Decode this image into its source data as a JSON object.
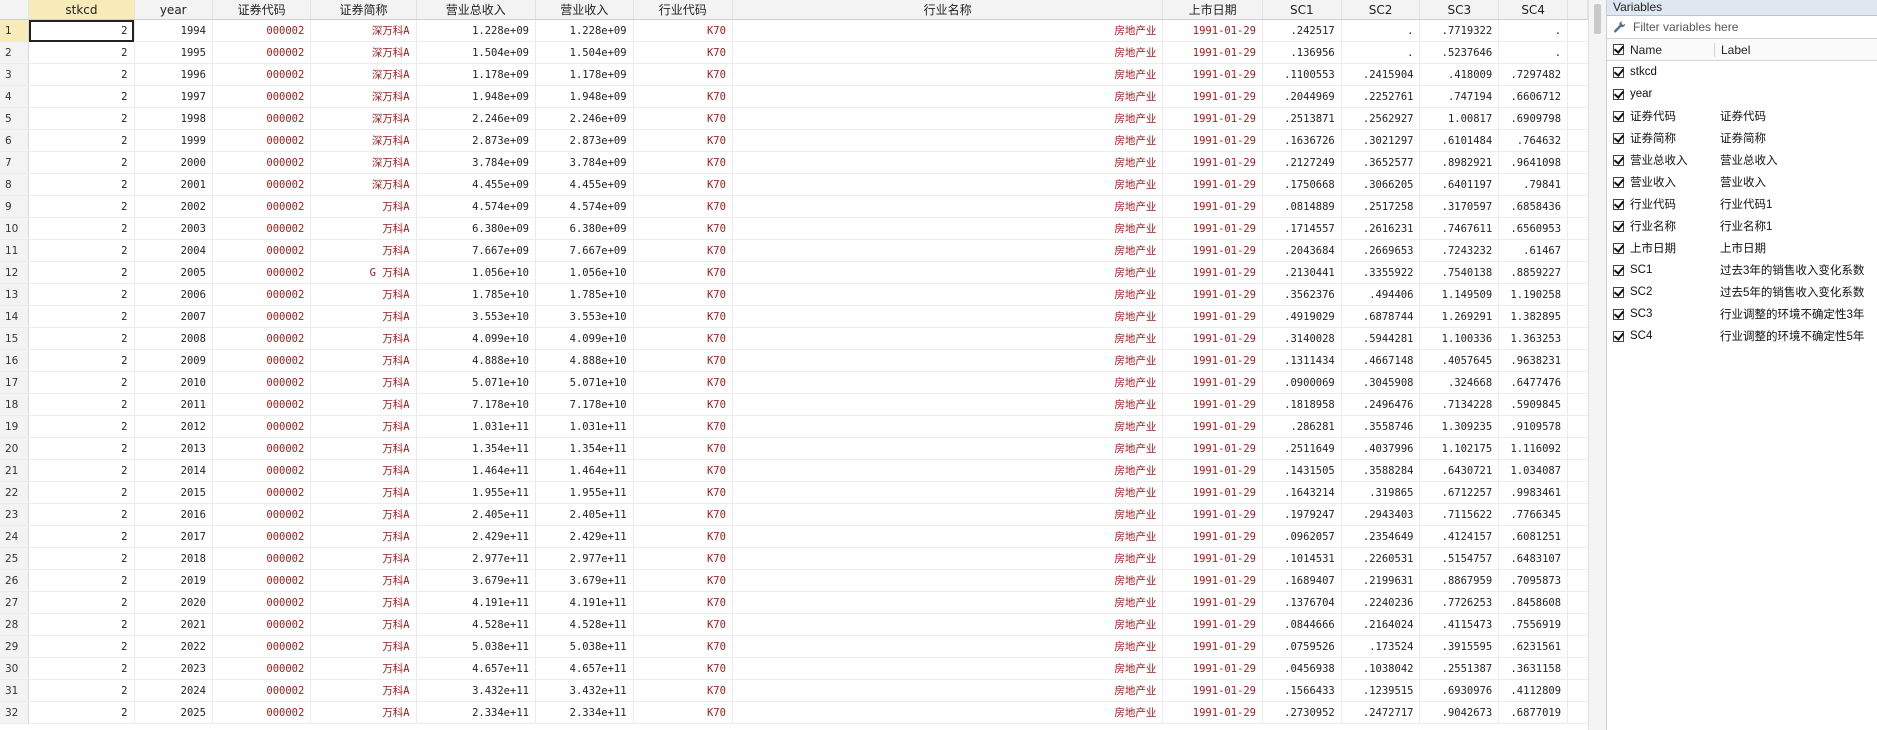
{
  "grid": {
    "columns": [
      {
        "key": "stkcd",
        "label": "stkcd",
        "type": "num",
        "width": 106
      },
      {
        "key": "year",
        "label": "year",
        "type": "num",
        "width": 79
      },
      {
        "key": "code",
        "label": "证券代码",
        "type": "str",
        "width": 99
      },
      {
        "key": "abbr",
        "label": "证券简称",
        "type": "str",
        "width": 106
      },
      {
        "key": "rev_total",
        "label": "营业总收入",
        "type": "num",
        "width": 120
      },
      {
        "key": "rev",
        "label": "营业收入",
        "type": "num",
        "width": 98
      },
      {
        "key": "ind_code",
        "label": "行业代码",
        "type": "str",
        "width": 100
      },
      {
        "key": "ind_name",
        "label": "行业名称",
        "type": "str",
        "width": 435
      },
      {
        "key": "list_date",
        "label": "上市日期",
        "type": "str",
        "width": 100
      },
      {
        "key": "sc1",
        "label": "SC1",
        "type": "num",
        "width": 79
      },
      {
        "key": "sc2",
        "label": "SC2",
        "type": "num",
        "width": 79
      },
      {
        "key": "sc3",
        "label": "SC3",
        "type": "num",
        "width": 79
      },
      {
        "key": "sc4",
        "label": "SC4",
        "type": "num",
        "width": 69
      }
    ],
    "rows": [
      [
        "1",
        "2",
        "1994",
        "000002",
        "深万科A",
        "1.228e+09",
        "1.228e+09",
        "K70",
        "房地产业",
        "1991-01-29",
        ".242517",
        ".",
        ".7719322",
        "."
      ],
      [
        "2",
        "2",
        "1995",
        "000002",
        "深万科A",
        "1.504e+09",
        "1.504e+09",
        "K70",
        "房地产业",
        "1991-01-29",
        ".136956",
        ".",
        ".5237646",
        "."
      ],
      [
        "3",
        "2",
        "1996",
        "000002",
        "深万科A",
        "1.178e+09",
        "1.178e+09",
        "K70",
        "房地产业",
        "1991-01-29",
        ".1100553",
        ".2415904",
        ".418009",
        ".7297482"
      ],
      [
        "4",
        "2",
        "1997",
        "000002",
        "深万科A",
        "1.948e+09",
        "1.948e+09",
        "K70",
        "房地产业",
        "1991-01-29",
        ".2044969",
        ".2252761",
        ".747194",
        ".6606712"
      ],
      [
        "5",
        "2",
        "1998",
        "000002",
        "深万科A",
        "2.246e+09",
        "2.246e+09",
        "K70",
        "房地产业",
        "1991-01-29",
        ".2513871",
        ".2562927",
        "1.00817",
        ".6909798"
      ],
      [
        "6",
        "2",
        "1999",
        "000002",
        "深万科A",
        "2.873e+09",
        "2.873e+09",
        "K70",
        "房地产业",
        "1991-01-29",
        ".1636726",
        ".3021297",
        ".6101484",
        ".764632"
      ],
      [
        "7",
        "2",
        "2000",
        "000002",
        "深万科A",
        "3.784e+09",
        "3.784e+09",
        "K70",
        "房地产业",
        "1991-01-29",
        ".2127249",
        ".3652577",
        ".8982921",
        ".9641098"
      ],
      [
        "8",
        "2",
        "2001",
        "000002",
        "深万科A",
        "4.455e+09",
        "4.455e+09",
        "K70",
        "房地产业",
        "1991-01-29",
        ".1750668",
        ".3066205",
        ".6401197",
        ".79841"
      ],
      [
        "9",
        "2",
        "2002",
        "000002",
        "万科A",
        "4.574e+09",
        "4.574e+09",
        "K70",
        "房地产业",
        "1991-01-29",
        ".0814889",
        ".2517258",
        ".3170597",
        ".6858436"
      ],
      [
        "10",
        "2",
        "2003",
        "000002",
        "万科A",
        "6.380e+09",
        "6.380e+09",
        "K70",
        "房地产业",
        "1991-01-29",
        ".1714557",
        ".2616231",
        ".7467611",
        ".6560953"
      ],
      [
        "11",
        "2",
        "2004",
        "000002",
        "万科A",
        "7.667e+09",
        "7.667e+09",
        "K70",
        "房地产业",
        "1991-01-29",
        ".2043684",
        ".2669653",
        ".7243232",
        ".61467"
      ],
      [
        "12",
        "2",
        "2005",
        "000002",
        "G 万科A",
        "1.056e+10",
        "1.056e+10",
        "K70",
        "房地产业",
        "1991-01-29",
        ".2130441",
        ".3355922",
        ".7540138",
        ".8859227"
      ],
      [
        "13",
        "2",
        "2006",
        "000002",
        "万科A",
        "1.785e+10",
        "1.785e+10",
        "K70",
        "房地产业",
        "1991-01-29",
        ".3562376",
        ".494406",
        "1.149509",
        "1.190258"
      ],
      [
        "14",
        "2",
        "2007",
        "000002",
        "万科A",
        "3.553e+10",
        "3.553e+10",
        "K70",
        "房地产业",
        "1991-01-29",
        ".4919029",
        ".6878744",
        "1.269291",
        "1.382895"
      ],
      [
        "15",
        "2",
        "2008",
        "000002",
        "万科A",
        "4.099e+10",
        "4.099e+10",
        "K70",
        "房地产业",
        "1991-01-29",
        ".3140028",
        ".5944281",
        "1.100336",
        "1.363253"
      ],
      [
        "16",
        "2",
        "2009",
        "000002",
        "万科A",
        "4.888e+10",
        "4.888e+10",
        "K70",
        "房地产业",
        "1991-01-29",
        ".1311434",
        ".4667148",
        ".4057645",
        ".9638231"
      ],
      [
        "17",
        "2",
        "2010",
        "000002",
        "万科A",
        "5.071e+10",
        "5.071e+10",
        "K70",
        "房地产业",
        "1991-01-29",
        ".0900069",
        ".3045908",
        ".324668",
        ".6477476"
      ],
      [
        "18",
        "2",
        "2011",
        "000002",
        "万科A",
        "7.178e+10",
        "7.178e+10",
        "K70",
        "房地产业",
        "1991-01-29",
        ".1818958",
        ".2496476",
        ".7134228",
        ".5909845"
      ],
      [
        "19",
        "2",
        "2012",
        "000002",
        "万科A",
        "1.031e+11",
        "1.031e+11",
        "K70",
        "房地产业",
        "1991-01-29",
        ".286281",
        ".3558746",
        "1.309235",
        ".9109578"
      ],
      [
        "20",
        "2",
        "2013",
        "000002",
        "万科A",
        "1.354e+11",
        "1.354e+11",
        "K70",
        "房地产业",
        "1991-01-29",
        ".2511649",
        ".4037996",
        "1.102175",
        "1.116092"
      ],
      [
        "21",
        "2",
        "2014",
        "000002",
        "万科A",
        "1.464e+11",
        "1.464e+11",
        "K70",
        "房地产业",
        "1991-01-29",
        ".1431505",
        ".3588284",
        ".6430721",
        "1.034087"
      ],
      [
        "22",
        "2",
        "2015",
        "000002",
        "万科A",
        "1.955e+11",
        "1.955e+11",
        "K70",
        "房地产业",
        "1991-01-29",
        ".1643214",
        ".319865",
        ".6712257",
        ".9983461"
      ],
      [
        "23",
        "2",
        "2016",
        "000002",
        "万科A",
        "2.405e+11",
        "2.405e+11",
        "K70",
        "房地产业",
        "1991-01-29",
        ".1979247",
        ".2943403",
        ".7115622",
        ".7766345"
      ],
      [
        "24",
        "2",
        "2017",
        "000002",
        "万科A",
        "2.429e+11",
        "2.429e+11",
        "K70",
        "房地产业",
        "1991-01-29",
        ".0962057",
        ".2354649",
        ".4124157",
        ".6081251"
      ],
      [
        "25",
        "2",
        "2018",
        "000002",
        "万科A",
        "2.977e+11",
        "2.977e+11",
        "K70",
        "房地产业",
        "1991-01-29",
        ".1014531",
        ".2260531",
        ".5154757",
        ".6483107"
      ],
      [
        "26",
        "2",
        "2019",
        "000002",
        "万科A",
        "3.679e+11",
        "3.679e+11",
        "K70",
        "房地产业",
        "1991-01-29",
        ".1689407",
        ".2199631",
        ".8867959",
        ".7095873"
      ],
      [
        "27",
        "2",
        "2020",
        "000002",
        "万科A",
        "4.191e+11",
        "4.191e+11",
        "K70",
        "房地产业",
        "1991-01-29",
        ".1376704",
        ".2240236",
        ".7726253",
        ".8458608"
      ],
      [
        "28",
        "2",
        "2021",
        "000002",
        "万科A",
        "4.528e+11",
        "4.528e+11",
        "K70",
        "房地产业",
        "1991-01-29",
        ".0844666",
        ".2164024",
        ".4115473",
        ".7556919"
      ],
      [
        "29",
        "2",
        "2022",
        "000002",
        "万科A",
        "5.038e+11",
        "5.038e+11",
        "K70",
        "房地产业",
        "1991-01-29",
        ".0759526",
        ".173524",
        ".3915595",
        ".6231561"
      ],
      [
        "30",
        "2",
        "2023",
        "000002",
        "万科A",
        "4.657e+11",
        "4.657e+11",
        "K70",
        "房地产业",
        "1991-01-29",
        ".0456938",
        ".1038042",
        ".2551387",
        ".3631158"
      ],
      [
        "31",
        "2",
        "2024",
        "000002",
        "万科A",
        "3.432e+11",
        "3.432e+11",
        "K70",
        "房地产业",
        "1991-01-29",
        ".1566433",
        ".1239515",
        ".6930976",
        ".4112809"
      ],
      [
        "32",
        "2",
        "2025",
        "000002",
        "万科A",
        "2.334e+11",
        "2.334e+11",
        "K70",
        "房地产业",
        "1991-01-29",
        ".2730952",
        ".2472717",
        ".9042673",
        ".6877019"
      ]
    ]
  },
  "variables_panel": {
    "title": "Variables",
    "filter_placeholder": "Filter variables here",
    "icon": "wrench-icon",
    "header_name": "Name",
    "header_label": "Label",
    "items": [
      {
        "name": "stkcd",
        "label": ""
      },
      {
        "name": "year",
        "label": ""
      },
      {
        "name": "证券代码",
        "label": "证券代码"
      },
      {
        "name": "证券简称",
        "label": "证券简称"
      },
      {
        "name": "营业总收入",
        "label": "营业总收入"
      },
      {
        "name": "营业收入",
        "label": "营业收入"
      },
      {
        "name": "行业代码",
        "label": "行业代码1"
      },
      {
        "name": "行业名称",
        "label": "行业名称1"
      },
      {
        "name": "上市日期",
        "label": "上市日期"
      },
      {
        "name": "SC1",
        "label": "过去3年的销售收入变化系数"
      },
      {
        "name": "SC2",
        "label": "过去5年的销售收入变化系数"
      },
      {
        "name": "SC3",
        "label": "行业调整的环境不确定性3年"
      },
      {
        "name": "SC4",
        "label": "行业调整的环境不确定性5年"
      }
    ]
  },
  "colors": {
    "string_text": "#9b1b1b",
    "selected_header": "#f7ebb9",
    "panel_title_bg": "#dfe7f1"
  }
}
